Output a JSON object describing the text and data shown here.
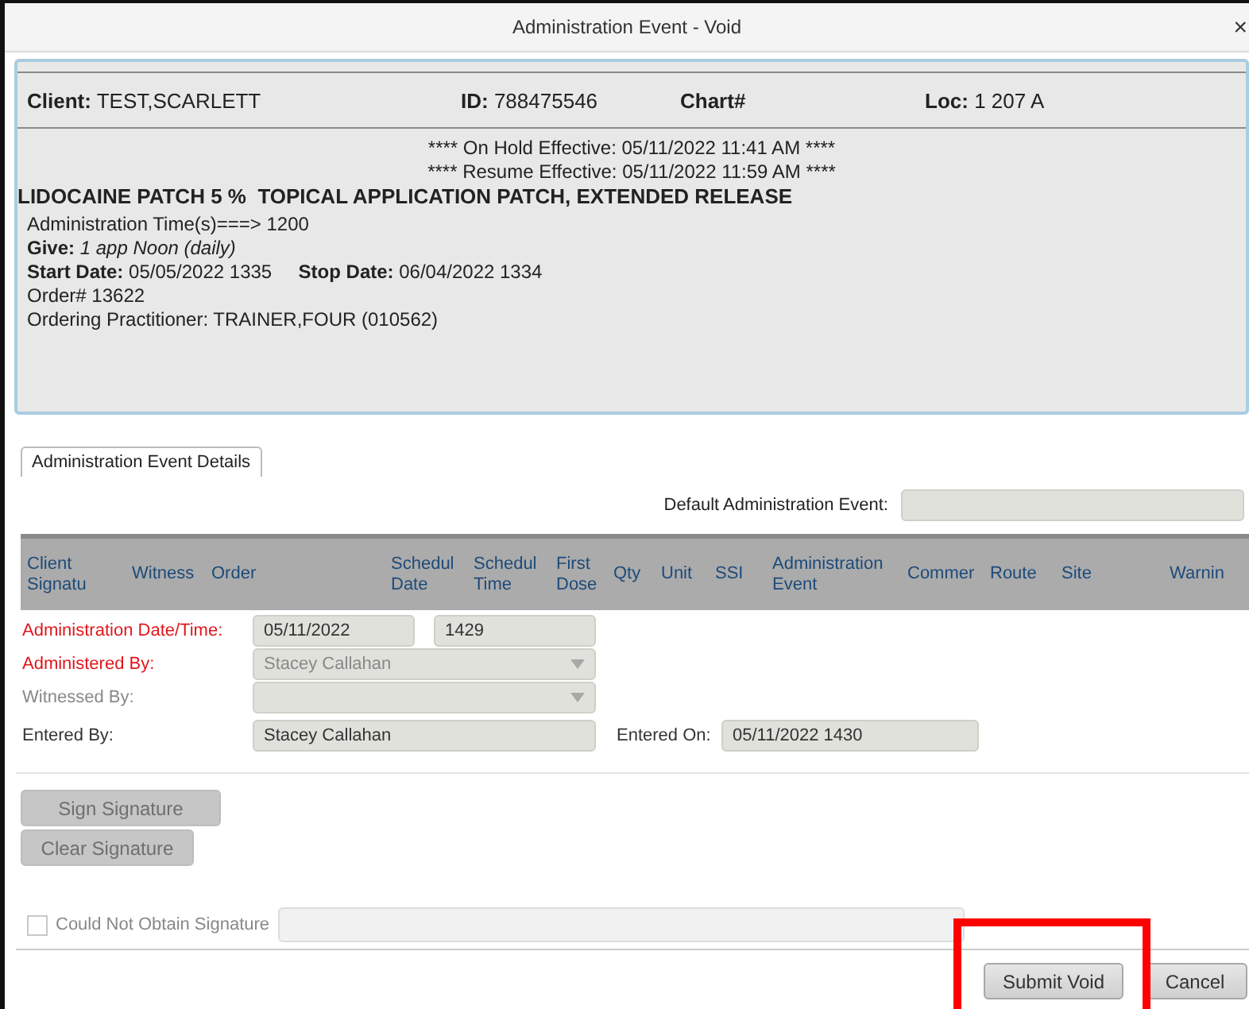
{
  "window": {
    "title": "Administration Event - Void",
    "close": "×"
  },
  "client_bar": [
    {
      "label": "Client:",
      "value": "TEST,SCARLETT"
    },
    {
      "label": "ID:",
      "value": "788475546"
    },
    {
      "label": "Chart#"
    },
    {
      "label": "Loc:",
      "value": "1 207 A"
    }
  ],
  "notices": [
    "**** On Hold Effective: 05/11/2022 11:41 AM ****",
    "**** Resume Effective: 05/11/2022 11:59 AM ****"
  ],
  "medication": "LIDOCAINE PATCH 5 %  TOPICAL APPLICATION PATCH, EXTENDED RELEASE",
  "order_lines": [
    "Administration Time(s)===> 1200",
    "**Give:** *1 app Noon (daily)*",
    "**Start Date:** 05/05/2022 1335     **Stop Date:** 06/04/2022 1334",
    "Order# 13622",
    "Ordering Practitioner: TRAINER,FOUR (010562)"
  ],
  "tabs": [
    {
      "label": "Administration Event Details",
      "selected": true
    }
  ],
  "default_event": {
    "label": "Default Administration Event:"
  },
  "grid": {
    "columns": [
      "Client\nSignatu",
      "Witness",
      "Order",
      "Schedul\nDate",
      "Schedul\nTime",
      "First\nDose",
      "Qty",
      "Unit",
      "SSI",
      "Administration\nEvent",
      "Commer",
      "Route",
      "Site",
      "Warnin"
    ]
  },
  "form": [
    {
      "kind": "date_time",
      "label": "Administration Date/Time:",
      "required": true,
      "disabled": false,
      "values": [
        "05/11/2022",
        "1429"
      ]
    },
    {
      "kind": "dropdown",
      "label": "Administered By:",
      "required": true,
      "disabled": false,
      "value": "Stacey Callahan"
    },
    {
      "kind": "dropdown",
      "label": "Witnessed By:",
      "required": false,
      "disabled": true
    },
    {
      "kind": "text_pair",
      "label": "Entered By:",
      "required": false,
      "disabled": false,
      "value": "Stacey Callahan",
      "second_label": "Entered On:",
      "second_value": "05/11/2022 1430"
    }
  ],
  "signature_buttons": [
    {
      "label": "Sign Signature",
      "disabled": true
    },
    {
      "label": "Clear Signature",
      "disabled": true
    }
  ],
  "could_not_obtain": {
    "label": "Could Not Obtain Signature",
    "checked": false
  },
  "footer_buttons": [
    {
      "label": "Submit Void",
      "highlighted": true
    },
    {
      "label": "Cancel",
      "highlighted": false
    }
  ]
}
